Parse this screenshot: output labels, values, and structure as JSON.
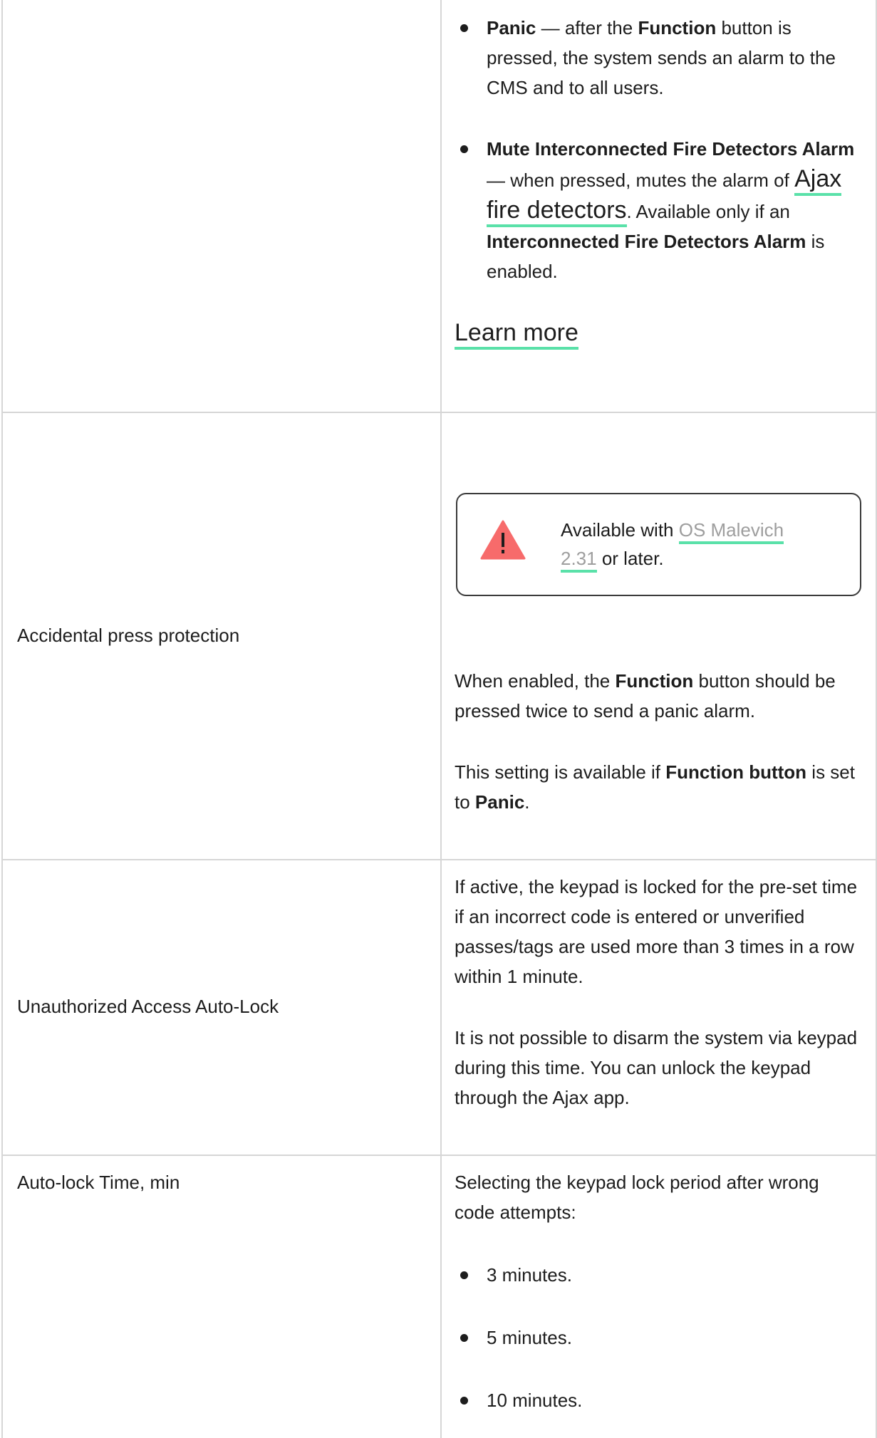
{
  "row1": {
    "items": [
      {
        "bold": "Panic",
        "rest": " — after the ",
        "bold2": "Function",
        "rest2": " button is pressed, the system sends an alarm to the CMS and to all users."
      },
      {
        "bold": "Mute Interconnected Fire Detectors Alarm",
        "rest": " — when pressed, mutes the alarm of ",
        "link": "Ajax fire detectors",
        "rest2": ". Available only if an ",
        "bold2": "Interconnected Fire Detectors Alarm",
        "rest3": " is enabled."
      }
    ],
    "learn_more": "Learn more"
  },
  "row2": {
    "label": "Accidental press protection",
    "notice": {
      "icon": "warning-triangle-icon",
      "prefix": "Available with ",
      "link_line1": "OS Malevich",
      "link_line2": "2.31",
      "suffix": " or later."
    },
    "p1_a": "When enabled, the ",
    "p1_b": "Function",
    "p1_c": " button should be pressed twice to send a panic alarm.",
    "p2_a": "This setting is available if ",
    "p2_b": "Function button",
    "p2_c": " is set to ",
    "p2_d": "Panic",
    "p2_e": "."
  },
  "row3": {
    "label": "Unauthorized Access Auto-Lock",
    "p1": "If active, the keypad is locked for the pre-set time if an incorrect code is entered or unverified passes/tags are used more than 3 times in a row within 1 minute.",
    "p2": "It is not possible to disarm the system via keypad during this time. You can unlock the keypad through the Ajax app."
  },
  "row4": {
    "label": "Auto-lock Time, min",
    "intro": "Selecting the keypad lock period after wrong code attempts:",
    "options": [
      "3 minutes.",
      "5 minutes.",
      "10 minutes."
    ]
  },
  "colors": {
    "link_underline": "#5ae1a9",
    "warning": "#f76b6b",
    "grid": "#d6d6d6"
  }
}
